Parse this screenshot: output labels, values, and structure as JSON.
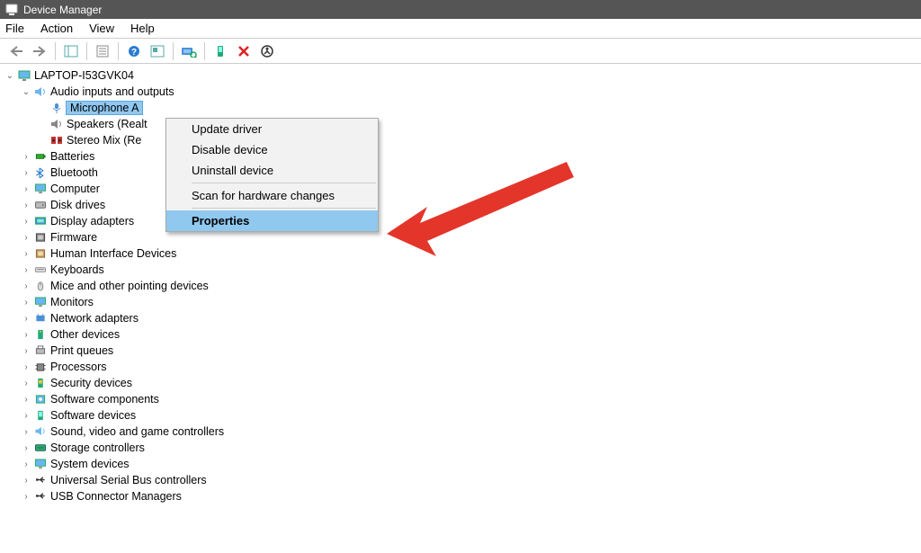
{
  "title": "Device Manager",
  "menu": {
    "file": "File",
    "action": "Action",
    "view": "View",
    "help": "Help"
  },
  "root": "LAPTOP-I53GVK04",
  "audio_group": "Audio inputs and outputs",
  "audio_items": {
    "mic": "Microphone A",
    "speakers": "Speakers (Realt",
    "stereo": "Stereo Mix (Re"
  },
  "categories": [
    "Batteries",
    "Bluetooth",
    "Computer",
    "Disk drives",
    "Display adapters",
    "Firmware",
    "Human Interface Devices",
    "Keyboards",
    "Mice and other pointing devices",
    "Monitors",
    "Network adapters",
    "Other devices",
    "Print queues",
    "Processors",
    "Security devices",
    "Software components",
    "Software devices",
    "Sound, video and game controllers",
    "Storage controllers",
    "System devices",
    "Universal Serial Bus controllers",
    "USB Connector Managers"
  ],
  "context": {
    "update": "Update driver",
    "disable": "Disable device",
    "uninstall": "Uninstall device",
    "scan": "Scan for hardware changes",
    "properties": "Properties"
  }
}
